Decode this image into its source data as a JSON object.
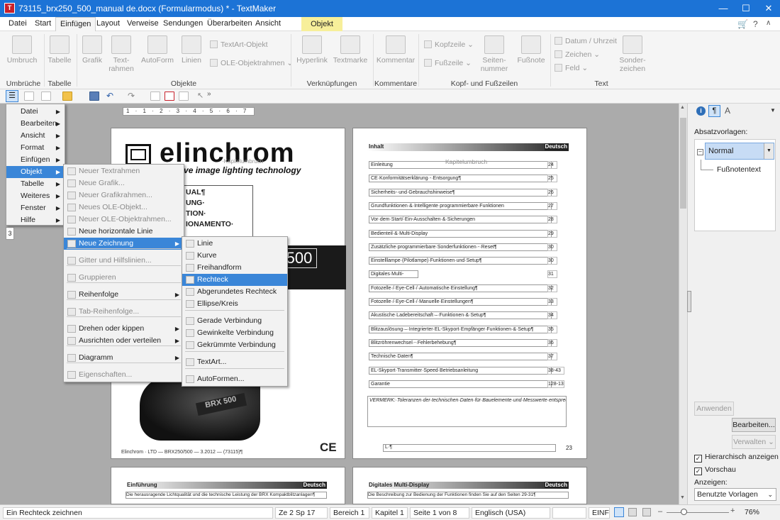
{
  "window": {
    "title": "73115_brx250_500_manual de.docx (Formularmodus) * - TextMaker",
    "app_icon": "textmaker-icon"
  },
  "menubar": {
    "tabs": [
      "Datei",
      "Start",
      "Einfügen",
      "Layout",
      "Verweise",
      "Sendungen",
      "Überarbeiten",
      "Ansicht"
    ],
    "context_tab": "Objekt",
    "right_icons": [
      "cart-icon",
      "help-icon",
      "ribbon-collapse-icon"
    ],
    "right_labels": [
      "?"
    ]
  },
  "ribbon": {
    "umbruch": "Umbruch",
    "tabelle": "Tabelle",
    "grafik": "Grafik",
    "textrahmen": "Text-\nrahmen",
    "autoform": "AutoForm",
    "linien": "Linien",
    "textart": "TextArt-Objekt",
    "ole": "OLE-Objektrahmen",
    "hyperlink": "Hyperlink",
    "textmarke": "Textmarke",
    "kommentar": "Kommentar",
    "kopfzeile": "Kopfzeile",
    "fusszeile": "Fußzeile",
    "seitennummer": "Seiten-\nnummer",
    "fussnote": "Fußnote",
    "datum": "Datum / Uhrzeit",
    "zeichen": "Zeichen",
    "feld": "Feld",
    "sonderzeichen": "Sonder-\nzeichen",
    "groups": [
      "Umbrüche",
      "Tabelle",
      "Objekte",
      "Verknüpfungen",
      "Kommentare",
      "Kopf- und Fußzeilen",
      "Text"
    ]
  },
  "ruler": {
    "marks": "1 · 1 · 2 · 3 · 4 · 5 · 6 · 7"
  },
  "main_menu": {
    "items": [
      "Datei",
      "Bearbeiten",
      "Ansicht",
      "Format",
      "Einfügen",
      "Objekt",
      "Tabelle",
      "Weiteres",
      "Fenster",
      "Hilfe"
    ],
    "highlighted": "Objekt"
  },
  "objekt_menu": {
    "items": [
      {
        "label": "Neuer Textrahmen",
        "disabled": true
      },
      {
        "label": "Neue Grafik...",
        "disabled": true
      },
      {
        "label": "Neuer Grafikrahmen...",
        "disabled": true
      },
      {
        "label": "Neues OLE-Objekt...",
        "disabled": true
      },
      {
        "label": "Neuer OLE-Objektrahmen...",
        "disabled": true
      },
      {
        "label": "Neue horizontale Linie",
        "disabled": false
      },
      {
        "label": "Neue Zeichnung",
        "disabled": false,
        "submenu": true,
        "highlighted": true
      },
      {
        "label": "Gitter und Hilfslinien...",
        "disabled": true
      },
      {
        "label": "Gruppieren",
        "disabled": true
      },
      {
        "label": "Reihenfolge",
        "disabled": false,
        "submenu": true
      },
      {
        "label": "Tab-Reihenfolge...",
        "disabled": true
      },
      {
        "label": "Drehen oder kippen",
        "disabled": false,
        "submenu": true
      },
      {
        "label": "Ausrichten oder verteilen",
        "disabled": false,
        "submenu": true
      },
      {
        "label": "Diagramm",
        "disabled": false,
        "submenu": true
      },
      {
        "label": "Eigenschaften...",
        "disabled": true
      }
    ]
  },
  "zeichnung_menu": {
    "items": [
      {
        "label": "Linie",
        "disabled": false
      },
      {
        "label": "Kurve",
        "disabled": false
      },
      {
        "label": "Freihandform",
        "disabled": false
      },
      {
        "label": "Rechteck",
        "disabled": false,
        "highlighted": true
      },
      {
        "label": "Abgerundetes Rechteck",
        "disabled": false
      },
      {
        "label": "Ellipse/Kreis",
        "disabled": false
      },
      {
        "label": "Gerade Verbindung",
        "disabled": false
      },
      {
        "label": "Gewinkelte Verbindung",
        "disabled": false
      },
      {
        "label": "Gekrümmte Verbindung",
        "disabled": false
      },
      {
        "label": "TextArt...",
        "disabled": false
      },
      {
        "label": "AutoFormen...",
        "disabled": false
      }
    ]
  },
  "page1": {
    "brand": "elinchrom",
    "tagline": "creative image lighting technology",
    "lines": [
      "UAL¶",
      "UNG·",
      "TION·",
      "IONAMENTO·"
    ],
    "model": "500",
    "footer": "Elinchrom · LTD — BRX250/500 — 3.2012 — (73115)¶",
    "ce": "CE",
    "note_line": "·Kapitelumbruch·"
  },
  "page2": {
    "header_left": "Inhalt",
    "header_right": "Deutsch",
    "chapter_break": "Kapitelumbruch",
    "toc": [
      {
        "t": "Einleitung",
        "p": "24"
      },
      {
        "t": "CE·Konformitätserklärung·-·Entsorgung¶",
        "p": "25"
      },
      {
        "t": "Sicherheits-·und·Gebrauchshinweise¶",
        "p": "26"
      },
      {
        "t": "Grundfunktionen·&·Intelligente·programmierbare·Funktionen",
        "p": "27"
      },
      {
        "t": "Vor·dem·Start/·Ein-Ausschalten·&·Sicherungen",
        "p": "28"
      },
      {
        "t": "Bedienteil·&·Multi-Display",
        "p": "29"
      },
      {
        "t": "Zusätzliche·programmierbare·Sonderfunktionen·-·Reset¶",
        "p": "30"
      },
      {
        "t": "Einstelllampe·(Pilotlampe)·Funktionen·und·Setup¶",
        "p": "30"
      },
      {
        "t": "Digitales·Multi-",
        "p": "31"
      },
      {
        "t": "Fotozelle·/·Eye-Cell·/·Automatische·Einstellung¶",
        "p": "32"
      },
      {
        "t": "Fotozelle·/·Eye-Cell·/·Manuelle·Einstellungen¶",
        "p": "33"
      },
      {
        "t": "Akustische·Ladebereitschaft·–·Funktionen·&·Setup¶",
        "p": "34"
      },
      {
        "t": "Blitzauslösung·–·Integrierter·EL-Skyport·Empfänger·Funktionen·&·Setup¶",
        "p": "35"
      },
      {
        "t": "Blitzröhrenwechsel·-·Fehlerbehebung¶",
        "p": "36"
      },
      {
        "t": "Technische·Daten¶",
        "p": "37"
      },
      {
        "t": "EL-Skyport·Transmitter·Speed·Betriebsanleitung",
        "p": "38-43"
      },
      {
        "t": "Garantie",
        "p": "128-130"
      }
    ],
    "note": "VERMERK:·Toleranzen·der·technischen·Daten·für·Bauelemente·und·Messwerte·entsprechen·den·IEC·und·EC·Normen.·Technische·Änderungen·vorbehalten.·Die·Werte·können·durch·Bauelemente·schwanken·und·sind·als·Richtwerte·zu·verstehen·und·nicht·im·rechtlichen·Sinne·als·zugesicherte·Eigenschaften.·Keine·Haftung·für·Druckfehler¶",
    "footer_left": "L·¶",
    "page_num": "23"
  },
  "page3": {
    "header_left": "Einführung",
    "header_right": "Deutsch",
    "body": "Die herausragende Lichtqualität und die technische Leistung der BRX Kompaktblitzanlagen¶"
  },
  "page4": {
    "header_left": "Digitales Multi-Display",
    "header_right": "Deutsch",
    "body": "Die Beschreibung zur Bedienung der Funktionen finden Sie auf den Seiten 29-31¶"
  },
  "side_marker": "3",
  "sidebar": {
    "label": "Absatzvorlagen:",
    "tree": [
      "Normal",
      "Fußnotentext"
    ],
    "anwenden": "Anwenden",
    "bearbeiten": "Bearbeiten...",
    "verwalten": "Verwalten",
    "hierarchisch": "Hierarchisch anzeigen",
    "vorschau": "Vorschau",
    "anzeigen": "Anzeigen:",
    "select_value": "Benutzte Vorlagen"
  },
  "status": {
    "message": "Ein Rechteck zeichnen",
    "pos": "Ze 2 Sp 17",
    "bereich": "Bereich 1",
    "kapitel": "Kapitel 1",
    "seite": "Seite 1 von 8",
    "sprache": "Englisch (USA)",
    "mode": "EINF",
    "zoom": "76%"
  },
  "colors": {
    "titlebar": "#1c73d6",
    "highlight": "#3a86d8",
    "context_tab": "#f7ef9a"
  }
}
